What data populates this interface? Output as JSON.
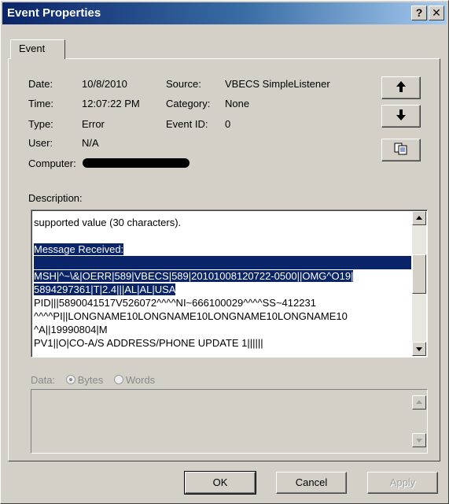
{
  "window": {
    "title": "Event Properties",
    "help_label": "?",
    "close_label": "✕"
  },
  "tabs": [
    "Event"
  ],
  "fields": {
    "date_label": "Date:",
    "date_value": "10/8/2010",
    "time_label": "Time:",
    "time_value": "12:07:22 PM",
    "type_label": "Type:",
    "type_value": "Error",
    "user_label": "User:",
    "user_value": "N/A",
    "computer_label": "Computer:",
    "source_label": "Source:",
    "source_value": "VBECS SimpleListener",
    "category_label": "Category:",
    "category_value": "None",
    "event_id_label": "Event ID:",
    "event_id_value": "0"
  },
  "nav_buttons": {
    "up": "🠕",
    "down": "🠗",
    "copy": "copy-icon"
  },
  "description": {
    "label": "Description:",
    "lines": [
      "supported value (30 characters).",
      "",
      "Message Received:",
      "",
      "MSH|^~\\&|OERR|589|VBECS|589|20101008120722-0500||OMG^O19|",
      "5894297361|T|2.4|||AL|AL|USA",
      "PID|||5890041517V526072^^^^NI~666100029^^^^SS~412231",
      "^^^^PI||LONGNAME10LONGNAME10LONGNAME10LONGNAME10",
      "^A||19990804|M",
      "PV1||O|CO-A/S ADDRESS/PHONE UPDATE 1||||||"
    ]
  },
  "data_section": {
    "label": "Data:",
    "bytes_label": "Bytes",
    "words_label": "Words",
    "selected": "Bytes"
  },
  "buttons": {
    "ok": "OK",
    "cancel": "Cancel",
    "apply": "Apply"
  },
  "colors": {
    "title_bar": "#0a246a",
    "selection": "#0a246a",
    "dialog_bg": "#d4d0c8"
  }
}
